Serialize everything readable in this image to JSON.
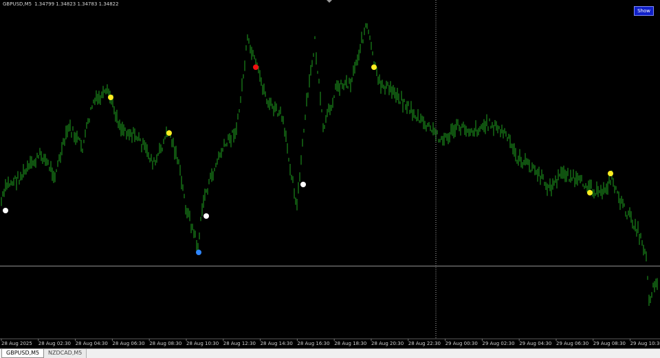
{
  "header": {
    "symbol": "GBPUSD,M5",
    "ohlc": "1.34799 1.34823 1.34783 1.34822"
  },
  "controls": {
    "show_label": "Show"
  },
  "tabs": [
    {
      "label": "GBPUSD,M5",
      "active": true
    },
    {
      "label": "NZDCAD,M5",
      "active": false
    }
  ],
  "time_axis": {
    "labels": [
      "28 Aug 2025",
      "28 Aug 02:30",
      "28 Aug 04:30",
      "28 Aug 06:30",
      "28 Aug 08:30",
      "28 Aug 10:30",
      "28 Aug 12:30",
      "28 Aug 14:30",
      "28 Aug 16:30",
      "28 Aug 18:30",
      "28 Aug 20:30",
      "28 Aug 22:30",
      "29 Aug 00:30",
      "29 Aug 02:30",
      "29 Aug 04:30",
      "29 Aug 06:30",
      "29 Aug 08:30",
      "29 Aug 10:30"
    ]
  },
  "colors": {
    "background": "#000000",
    "candle": "#1fa31f",
    "crosshair": "#9a9a9a",
    "dot_yellow": "#ffee22",
    "dot_white": "#ffffff",
    "dot_red": "#ee1111",
    "dot_blue": "#2f86ff"
  }
}
